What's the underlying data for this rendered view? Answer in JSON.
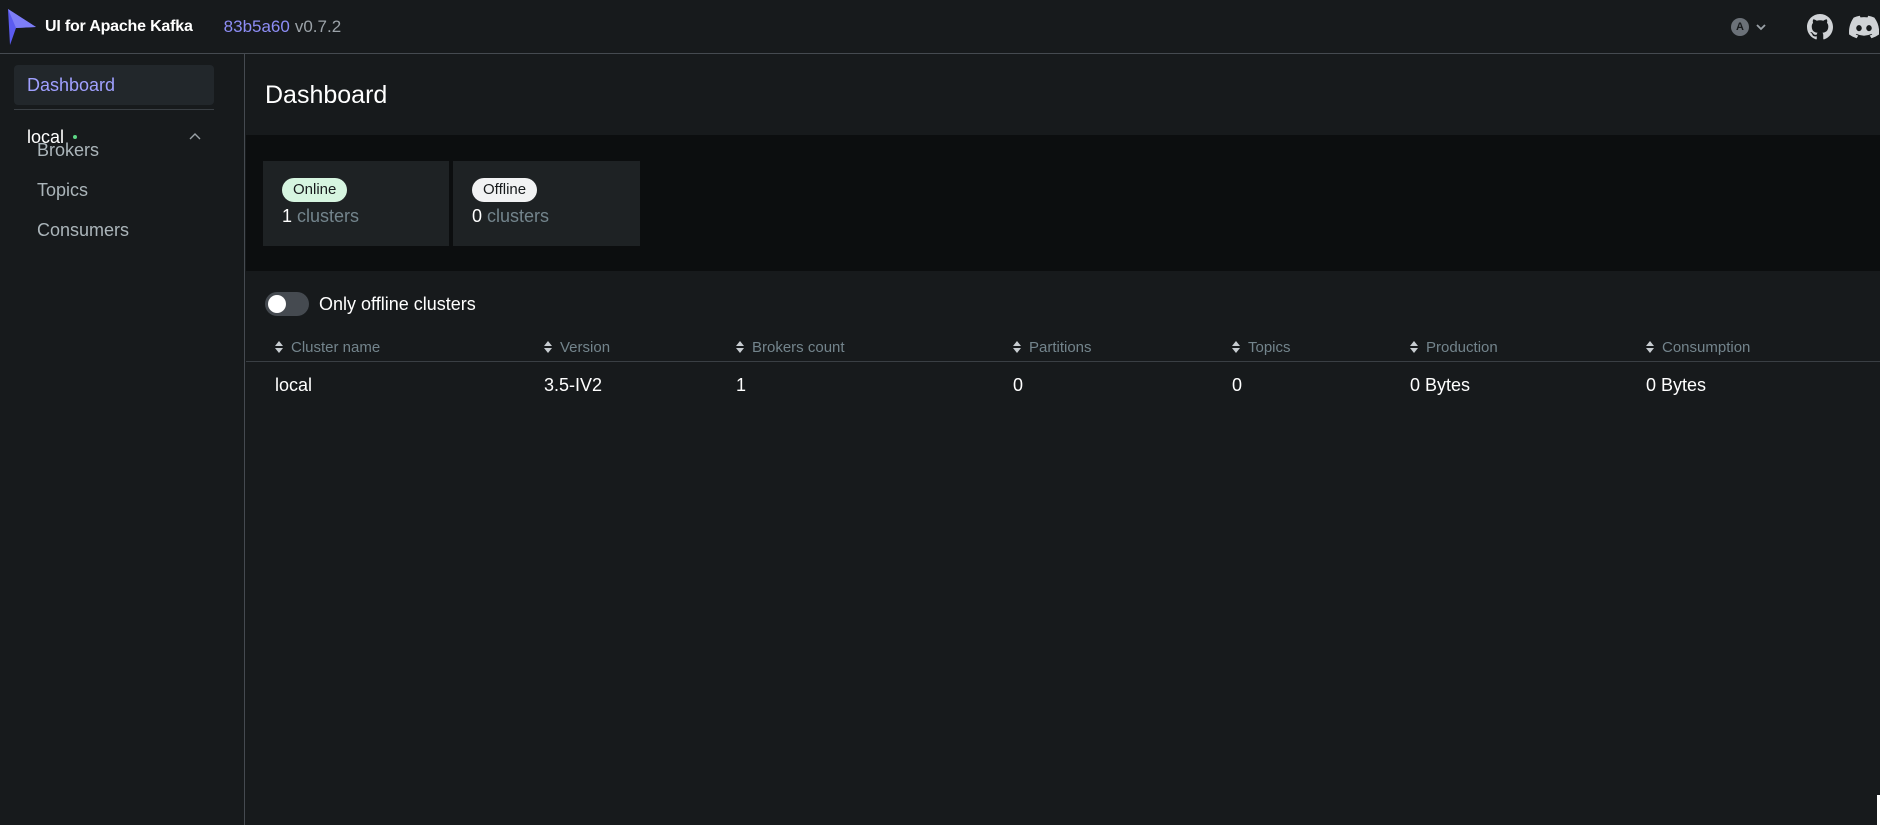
{
  "app": {
    "title": "UI for Apache Kafka",
    "commit_hash": "83b5a60",
    "version": "v0.7.2",
    "language_icon_letter": "A"
  },
  "sidebar": {
    "dashboard_label": "Dashboard",
    "cluster": {
      "name": "local",
      "status_color": "#5cd685",
      "items": [
        {
          "label": "Brokers"
        },
        {
          "label": "Topics"
        },
        {
          "label": "Consumers"
        }
      ]
    }
  },
  "main": {
    "title": "Dashboard",
    "metrics": [
      {
        "badge": "Online",
        "value": "1",
        "unit": "clusters"
      },
      {
        "badge": "Offline",
        "value": "0",
        "unit": "clusters"
      }
    ],
    "toggle_label": "Only offline clusters",
    "toggle_on": false,
    "table": {
      "columns": [
        "Cluster name",
        "Version",
        "Brokers count",
        "Partitions",
        "Topics",
        "Production",
        "Consumption"
      ],
      "rows": [
        [
          "local",
          "3.5-IV2",
          "1",
          "0",
          "0",
          "0 Bytes",
          "0 Bytes"
        ]
      ]
    }
  },
  "colors": {
    "accent": "#a0a0ff",
    "background": "#171a1c",
    "online_badge": "#d6f5e0"
  },
  "icons": [
    "kafka-logo-icon",
    "language-icon",
    "chevron-down-icon",
    "github-icon",
    "discord-icon",
    "chevron-up-icon",
    "sort-icon"
  ]
}
